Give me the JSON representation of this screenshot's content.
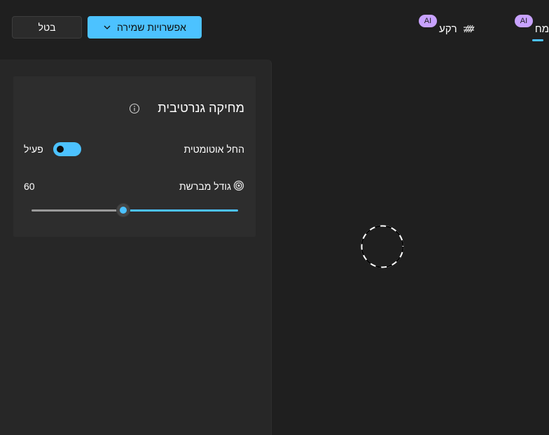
{
  "toolbar": {
    "cancel_label": "בטל",
    "save_options_label": "אפשרויות שמירה"
  },
  "tabs": [
    {
      "label": "רקע",
      "badge": "AI",
      "icon": "background-pattern-icon"
    },
    {
      "label": "מחק",
      "badge": "AI",
      "icon": "eraser-icon",
      "selected": true
    }
  ],
  "panel": {
    "title": "מחיקה גנרטיבית",
    "auto_apply": {
      "label": "החל אוטומטית",
      "state_text": "פעיל",
      "on": true
    },
    "brush_size": {
      "label": "גודל מברשת",
      "value": "60",
      "fraction": 0.445
    }
  },
  "colors": {
    "accent": "#4cc2ff",
    "ai_badge": "#c8a2ff",
    "background": "#1f1f1f",
    "panel": "#272727",
    "card": "#2d2d2d"
  }
}
